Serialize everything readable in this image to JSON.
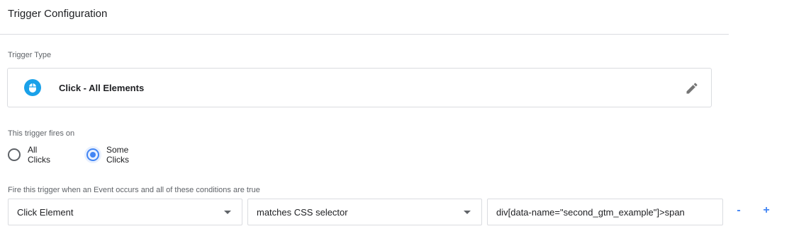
{
  "header": {
    "title": "Trigger Configuration"
  },
  "trigger_type": {
    "label": "Trigger Type",
    "name": "Click - All Elements",
    "icon": "mouse-icon",
    "icon_color": "#1aa1e9",
    "edit_icon": "pencil-icon"
  },
  "fires_on": {
    "label": "This trigger fires on",
    "options": [
      {
        "label": "All Clicks",
        "checked": false
      },
      {
        "label": "Some Clicks",
        "checked": true
      }
    ]
  },
  "conditions": {
    "label": "Fire this trigger when an Event occurs and all of these conditions are true",
    "variable": "Click Element",
    "operator": "matches CSS selector",
    "value": "div[data-name=\"second_gtm_example\"]>span",
    "remove_label": "-",
    "add_label": "+"
  },
  "colors": {
    "accent": "#4285f4",
    "border": "#dadce0",
    "muted": "#5f6368"
  }
}
